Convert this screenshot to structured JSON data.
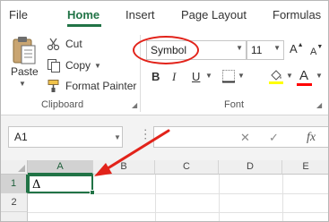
{
  "ribbon_tabs": [
    {
      "label": "File"
    },
    {
      "label": "Home"
    },
    {
      "label": "Insert"
    },
    {
      "label": "Page Layout"
    },
    {
      "label": "Formulas"
    }
  ],
  "clipboard": {
    "paste_label": "Paste",
    "cut_label": "Cut",
    "copy_label": "Copy",
    "format_painter_label": "Format Painter",
    "group_label": "Clipboard"
  },
  "font": {
    "name_value": "Symbol",
    "size_value": "11",
    "bold_label": "B",
    "italic_label": "I",
    "underline_label": "U",
    "group_label": "Font",
    "fill_color": "#ffff00",
    "font_color": "#ff0000"
  },
  "formula_bar": {
    "name_box_value": "A1",
    "cancel_icon": "✕",
    "enter_icon": "✓",
    "function_icon": "fx"
  },
  "grid": {
    "columns": [
      "A",
      "B",
      "C",
      "D",
      "E"
    ],
    "rows": [
      "1",
      "2"
    ],
    "selected_cell_value": "Δ"
  },
  "colors": {
    "accent": "#217346",
    "annotation": "#e2231a"
  }
}
